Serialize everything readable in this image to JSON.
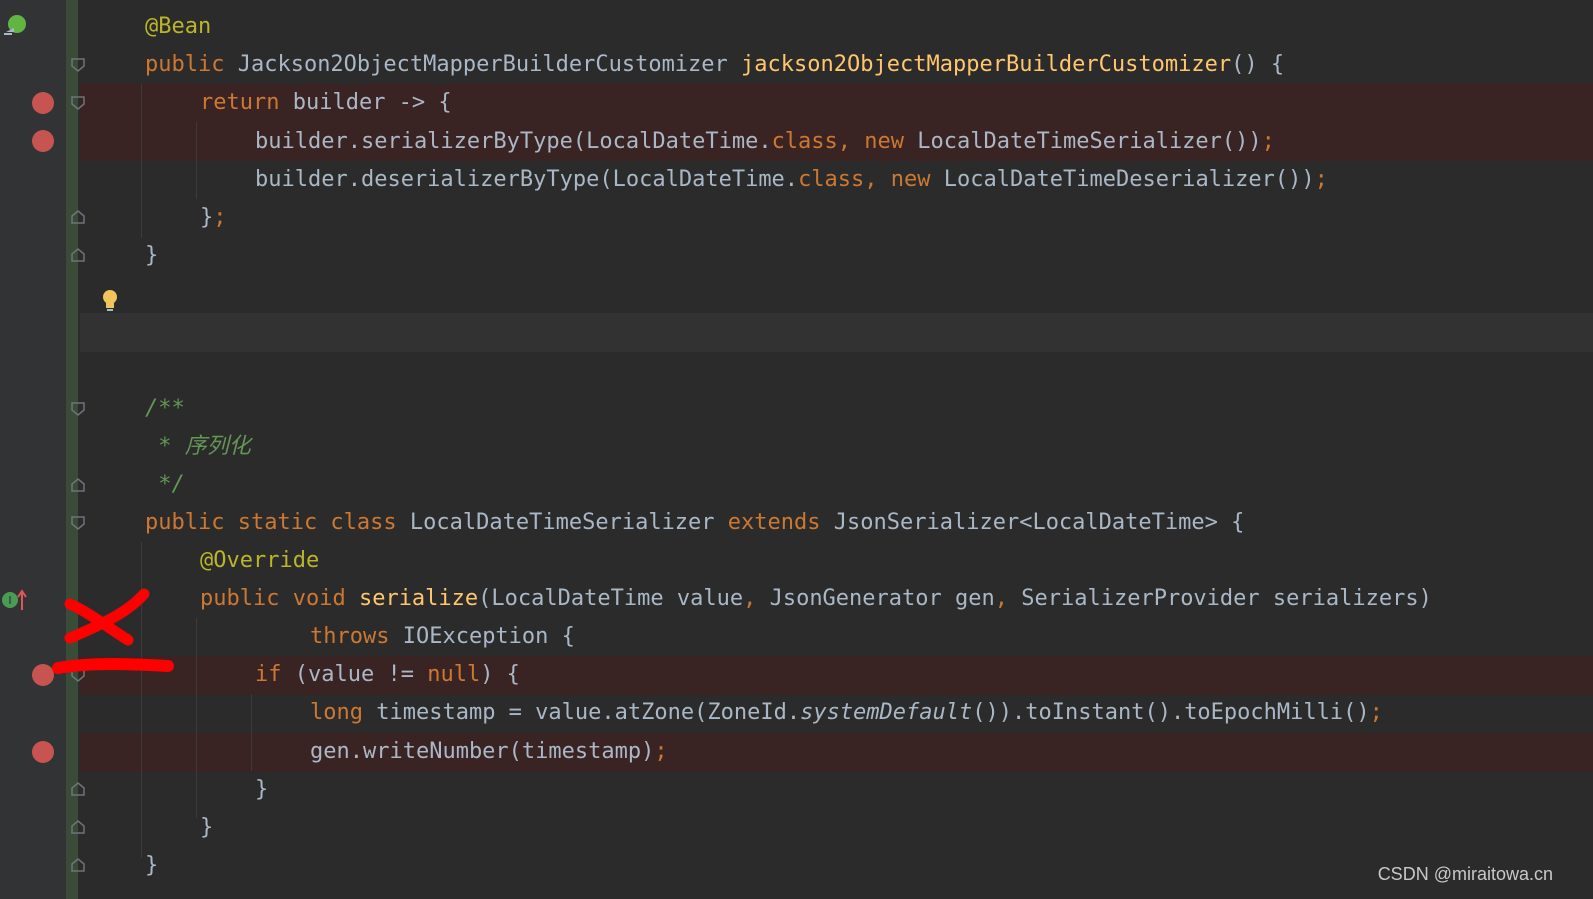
{
  "code_lines": [
    [
      {
        "t": "@Bean",
        "c": "ann"
      }
    ],
    [
      {
        "t": "public ",
        "c": "kw"
      },
      {
        "t": "Jackson2ObjectMapperBuilderCustomizer "
      },
      {
        "t": "jackson2ObjectMapperBuilderCustomizer",
        "c": "fn"
      },
      {
        "t": "() {"
      }
    ],
    [
      {
        "t": "return ",
        "c": "kw"
      },
      {
        "t": "builder -> {"
      }
    ],
    [
      {
        "t": "builder.serializerByType(LocalDateTime."
      },
      {
        "t": "class",
        "c": "kw"
      },
      {
        "t": ", ",
        "c": "kw"
      },
      {
        "t": "new ",
        "c": "kw"
      },
      {
        "t": "LocalDateTimeSerializer())"
      },
      {
        "t": ";",
        "c": "kw"
      }
    ],
    [
      {
        "t": "builder.deserializerByType(LocalDateTime."
      },
      {
        "t": "class",
        "c": "kw"
      },
      {
        "t": ", ",
        "c": "kw"
      },
      {
        "t": "new ",
        "c": "kw"
      },
      {
        "t": "LocalDateTimeDeserializer())"
      },
      {
        "t": ";",
        "c": "kw"
      }
    ],
    [
      {
        "t": "}"
      },
      {
        "t": ";",
        "c": "kw"
      }
    ],
    [
      {
        "t": "}"
      }
    ],
    [
      {
        "t": "/**",
        "c": "cm"
      }
    ],
    [
      {
        "t": " * 序列化",
        "c": "cm"
      }
    ],
    [
      {
        "t": " */",
        "c": "cm"
      }
    ],
    [
      {
        "t": "public static class ",
        "c": "kw"
      },
      {
        "t": "LocalDateTimeSerializer "
      },
      {
        "t": "extends ",
        "c": "kw"
      },
      {
        "t": "JsonSerializer<LocalDateTime> {"
      }
    ],
    [
      {
        "t": "@Override",
        "c": "ann"
      }
    ],
    [
      {
        "t": "public void ",
        "c": "kw"
      },
      {
        "t": "serialize",
        "c": "fn"
      },
      {
        "t": "(LocalDateTime value"
      },
      {
        "t": ", ",
        "c": "kw"
      },
      {
        "t": "JsonGenerator gen"
      },
      {
        "t": ", ",
        "c": "kw"
      },
      {
        "t": "SerializerProvider serializers)"
      }
    ],
    [
      {
        "t": "throws ",
        "c": "kw"
      },
      {
        "t": "IOException {"
      }
    ],
    [
      {
        "t": "if ",
        "c": "kw"
      },
      {
        "t": "(value != "
      },
      {
        "t": "null",
        "c": "kw"
      },
      {
        "t": ") {"
      }
    ],
    [
      {
        "t": "long ",
        "c": "kw"
      },
      {
        "t": "timestamp = value.atZone(ZoneId."
      },
      {
        "t": "systemDefault",
        "c": "it"
      },
      {
        "t": "()).toInstant().toEpochMilli()"
      },
      {
        "t": ";",
        "c": "kw"
      }
    ],
    [
      {
        "t": "gen.writeNumber(timestamp)"
      },
      {
        "t": ";",
        "c": "kw"
      }
    ],
    [
      {
        "t": "}"
      }
    ],
    [
      {
        "t": "}"
      }
    ],
    [
      {
        "t": "}"
      }
    ]
  ],
  "icons": {
    "bean_gutter": "spring-bean-icon",
    "intention": "lightbulb-icon",
    "override": "implements-method-icon",
    "breakpoint": "breakpoint-icon",
    "fold": "fold-marker-icon"
  },
  "colors": {
    "background": "#2b2b2b",
    "keyword": "#cc7832",
    "annotation": "#bbb529",
    "method": "#ffc66d",
    "comment": "#629755",
    "text": "#a9b7c6",
    "breakpoint": "#c75450",
    "red_mark": "#ff0000"
  },
  "watermark": "CSDN @miraitowa.cn"
}
